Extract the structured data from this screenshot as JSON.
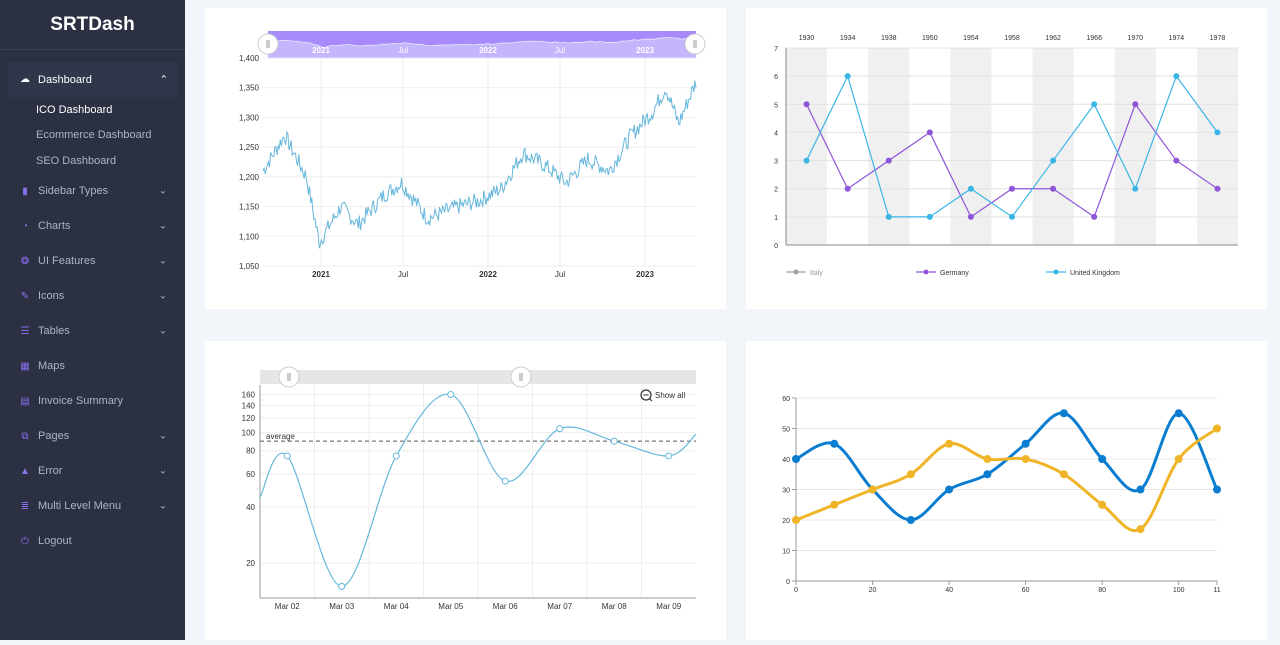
{
  "brand": "SRTDash",
  "menu": {
    "dashboard": "Dashboard",
    "sub": [
      "ICO Dashboard",
      "Ecommerce Dashboard",
      "SEO Dashboard"
    ],
    "items": [
      "Sidebar Types",
      "Charts",
      "UI Features",
      "Icons",
      "Tables",
      "Maps",
      "Invoice Summary",
      "Pages",
      "Error",
      "Multi Level Menu",
      "Logout"
    ]
  },
  "colors": {
    "sidebar": "#2b3142",
    "accent": "#8c6ff0",
    "line_blue": "#67b7dc",
    "series_purple": "#8f55d8",
    "series_cyan": "#3bb5e6",
    "bold_blue": "#0b7dd0",
    "bold_yellow": "#f0b428"
  },
  "chart_data": [
    {
      "type": "line",
      "title": "",
      "x_ticks": [
        "2021",
        "Jul",
        "2022",
        "Jul",
        "2023"
      ],
      "y_ticks": [
        "1,050",
        "1,100",
        "1,150",
        "1,200",
        "1,250",
        "1,300",
        "1,350",
        "1,400"
      ],
      "ylim": [
        1050,
        1400
      ],
      "keypoints": [
        [
          0,
          1210
        ],
        [
          0.05,
          1270
        ],
        [
          0.1,
          1200
        ],
        [
          0.13,
          1090
        ],
        [
          0.18,
          1150
        ],
        [
          0.22,
          1120
        ],
        [
          0.28,
          1170
        ],
        [
          0.32,
          1190
        ],
        [
          0.38,
          1130
        ],
        [
          0.45,
          1150
        ],
        [
          0.5,
          1160
        ],
        [
          0.55,
          1180
        ],
        [
          0.6,
          1240
        ],
        [
          0.65,
          1220
        ],
        [
          0.7,
          1190
        ],
        [
          0.75,
          1230
        ],
        [
          0.8,
          1210
        ],
        [
          0.85,
          1270
        ],
        [
          0.9,
          1310
        ],
        [
          0.93,
          1350
        ],
        [
          0.96,
          1290
        ],
        [
          1.0,
          1360
        ]
      ],
      "scrollbar": true
    },
    {
      "type": "line",
      "categories": [
        "1930",
        "1934",
        "1938",
        "1950",
        "1954",
        "1958",
        "1962",
        "1966",
        "1970",
        "1974",
        "1978"
      ],
      "ylim": [
        0,
        7
      ],
      "y_ticks": [
        "0",
        "1",
        "2",
        "3",
        "4",
        "5",
        "6",
        "7"
      ],
      "series": [
        {
          "name": "Italy",
          "values": [],
          "color": "#a0a0a0"
        },
        {
          "name": "Germany",
          "values": [
            5,
            2,
            3,
            4,
            1,
            2,
            2,
            1,
            5,
            3,
            2
          ],
          "color": "#8f55d8"
        },
        {
          "name": "United Kingdom",
          "values": [
            3,
            6,
            1,
            1,
            2,
            1,
            3,
            5,
            2,
            6,
            4
          ],
          "color": "#3bb5e6"
        }
      ]
    },
    {
      "type": "line",
      "categories": [
        "Mar 02",
        "Mar 03",
        "Mar 04",
        "Mar 05",
        "Mar 06",
        "Mar 07",
        "Mar 08",
        "Mar 09"
      ],
      "y_ticks": [
        "20",
        "40",
        "60",
        "80",
        "100",
        "120",
        "140",
        "160"
      ],
      "scale": "log",
      "values": [
        75,
        15,
        75,
        160,
        55,
        105,
        90,
        75
      ],
      "guide_label": "average",
      "guide_value": 90,
      "show_all": "Show all"
    },
    {
      "type": "line",
      "x_ticks": [
        "0",
        "20",
        "40",
        "60",
        "80",
        "100",
        "11"
      ],
      "ylim": [
        0,
        60
      ],
      "y_ticks": [
        "0",
        "10",
        "20",
        "30",
        "40",
        "50",
        "60"
      ],
      "series": [
        {
          "values": [
            [
              0,
              40
            ],
            [
              10,
              45
            ],
            [
              20,
              30
            ],
            [
              30,
              20
            ],
            [
              40,
              30
            ],
            [
              50,
              35
            ],
            [
              60,
              45
            ],
            [
              70,
              55
            ],
            [
              80,
              40
            ],
            [
              90,
              30
            ],
            [
              100,
              55
            ],
            [
              110,
              30
            ]
          ],
          "color": "#0b7dd0"
        },
        {
          "values": [
            [
              0,
              20
            ],
            [
              10,
              25
            ],
            [
              20,
              30
            ],
            [
              30,
              35
            ],
            [
              40,
              45
            ],
            [
              50,
              40
            ],
            [
              60,
              40
            ],
            [
              70,
              35
            ],
            [
              80,
              25
            ],
            [
              90,
              17
            ],
            [
              100,
              40
            ],
            [
              110,
              50
            ]
          ],
          "color": "#f0b428"
        }
      ]
    }
  ]
}
